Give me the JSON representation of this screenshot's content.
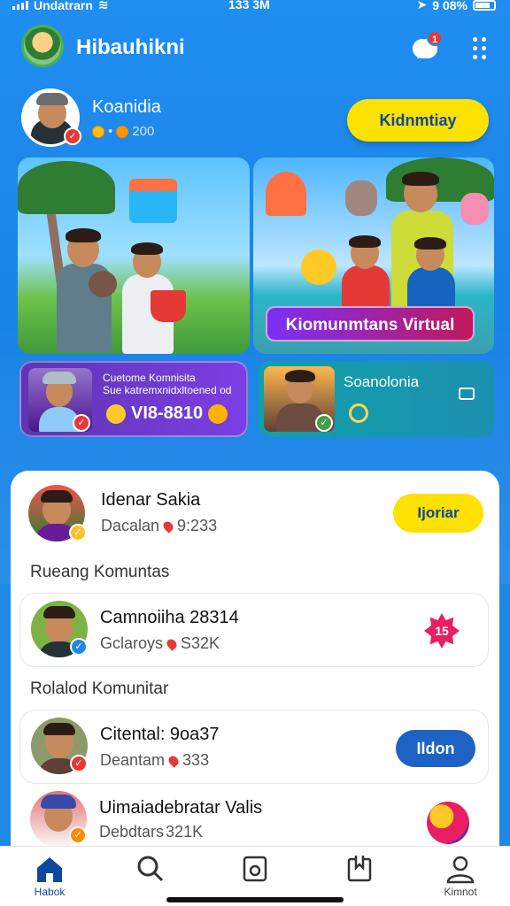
{
  "status_bar": {
    "carrier": "Undatrarn",
    "time": "133 3M",
    "battery": "9 08%"
  },
  "app": {
    "title": "Hibauhikni"
  },
  "header": {
    "notifications_count": "1"
  },
  "profile": {
    "name": "Koanidia",
    "stats": "200",
    "cta_label": "Kidnmtiay"
  },
  "promos": {
    "card_b_label": "Kiomunmtans Virtual",
    "card_c": {
      "line1": "Cuetome Komnisita",
      "line2": "Sue katremxnidxltoened od",
      "value": "VI8-8810"
    },
    "card_d": {
      "title": "Soanolonia"
    }
  },
  "featured": {
    "name": "Idenar Sakia",
    "sub_prefix": "Dacalan",
    "sub_value": "9:233",
    "button": "Ijoriar"
  },
  "sections": [
    {
      "title": "Rueang Komuntas",
      "items": [
        {
          "name": "Camnoiiha 28314",
          "sub_prefix": "Gclaroys",
          "sub_value": "S32K",
          "badge": "15"
        }
      ]
    },
    {
      "title": "Rolalod Komunitar",
      "items": [
        {
          "name": "Citental: 9oa37",
          "sub_prefix": "Deantam",
          "sub_value": "333",
          "button": "Ildon"
        },
        {
          "name": "Uimaiadebratar Valis",
          "sub_prefix": "Debdtars",
          "sub_value": "321K"
        }
      ]
    }
  ],
  "bottom_nav": [
    {
      "label": "Habok",
      "icon": "home-icon",
      "active": true
    },
    {
      "label": "",
      "icon": "search-icon",
      "active": false
    },
    {
      "label": "",
      "icon": "device-icon",
      "active": false
    },
    {
      "label": "",
      "icon": "bookmark-icon",
      "active": false
    },
    {
      "label": "Kimnot",
      "icon": "profile-icon",
      "active": false
    }
  ],
  "colors": {
    "primary_blue": "#1e88e5",
    "accent_yellow": "#fde100",
    "button_blue": "#1e63c4",
    "badge_red": "#e53935",
    "nav_active": "#0d47a1"
  }
}
